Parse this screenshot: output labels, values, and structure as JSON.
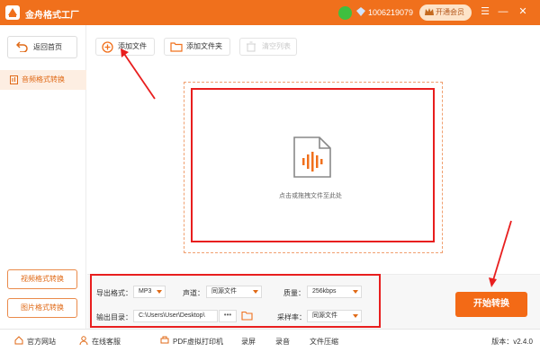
{
  "app": {
    "title": "金舟格式工厂",
    "user_id": "1006219079",
    "vip_label": "开通会员"
  },
  "sidebar": {
    "back_label": "返回首页",
    "active_item": "音频格式转换",
    "bottom_buttons": [
      "视频格式转换",
      "图片格式转换"
    ]
  },
  "toolbar": {
    "add_file": "添加文件",
    "add_folder": "添加文件夹",
    "clear_list": "清空列表"
  },
  "dropzone": {
    "hint": "点击或拖拽文件至此处"
  },
  "settings": {
    "export_format_label": "导出格式：",
    "export_format_value": "MP3",
    "channel_label": "声道：",
    "channel_value": "同源文件",
    "quality_label": "质量：",
    "quality_value": "256kbps",
    "output_dir_label": "输出目录：",
    "output_dir_value": "C:\\Users\\User\\Desktop\\",
    "sample_rate_label": "采样率：",
    "sample_rate_value": "同源文件",
    "dots": "•••"
  },
  "start_button": "开始转换",
  "footer": {
    "items": [
      "官方网站",
      "在线客服",
      "PDF虚拟打印机",
      "录屏",
      "录音",
      "文件压缩"
    ],
    "version": "版本：v2.4.0"
  },
  "colors": {
    "accent": "#f0701c",
    "annotation": "#e81e1e"
  }
}
